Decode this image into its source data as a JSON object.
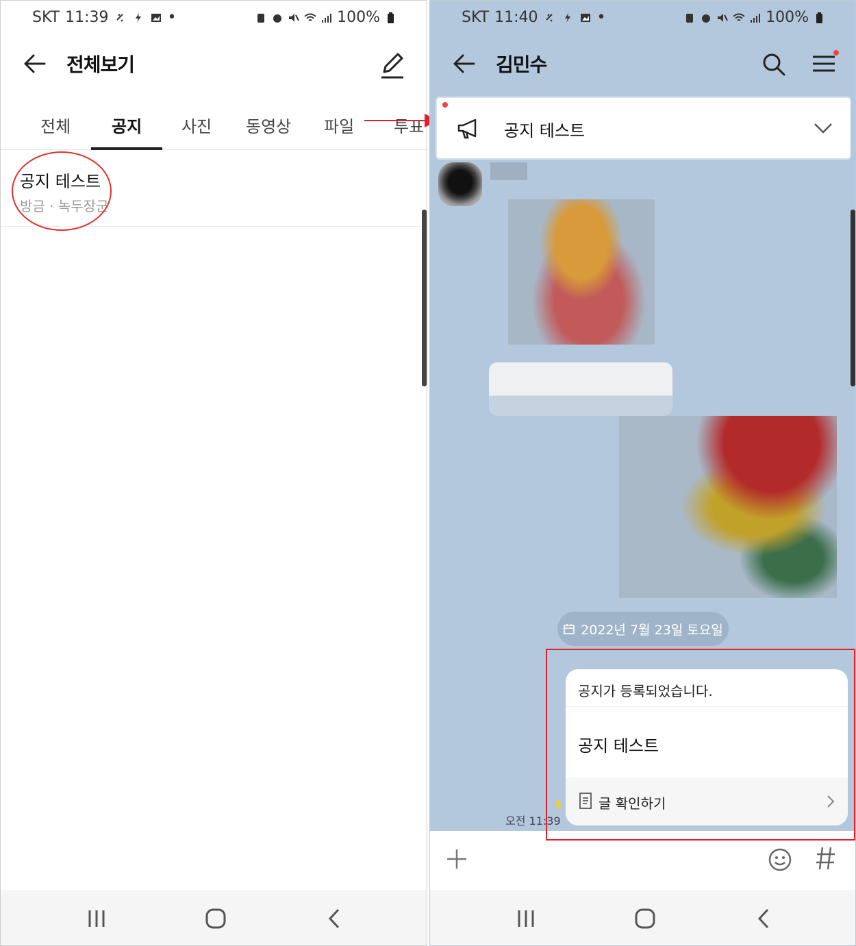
{
  "left": {
    "status": {
      "carrier": "SKT",
      "time": "11:39",
      "battery": "100%"
    },
    "header": {
      "title": "전체보기"
    },
    "tabs": [
      {
        "label": "전체"
      },
      {
        "label": "공지"
      },
      {
        "label": "사진"
      },
      {
        "label": "동영상"
      },
      {
        "label": "파일"
      },
      {
        "label": "투표"
      }
    ],
    "active_tab": "공지",
    "notices": [
      {
        "title": "공지 테스트",
        "meta": "방금 · 녹두장군"
      }
    ]
  },
  "right": {
    "status": {
      "carrier": "SKT",
      "time": "11:40",
      "battery": "100%"
    },
    "header": {
      "title": "김민수"
    },
    "banner": {
      "text": "공지 테스트"
    },
    "date_divider": "2022년 7월 23일 토요일",
    "message": {
      "header": "공지가 등록되었습니다.",
      "body": "공지 테스트",
      "link": "글 확인하기",
      "time": "오전 11:39",
      "unread": "1"
    }
  },
  "colors": {
    "chat_bg": "#b3c8dd",
    "annotation_red": "#e0202a",
    "active_tab": "#222222"
  }
}
